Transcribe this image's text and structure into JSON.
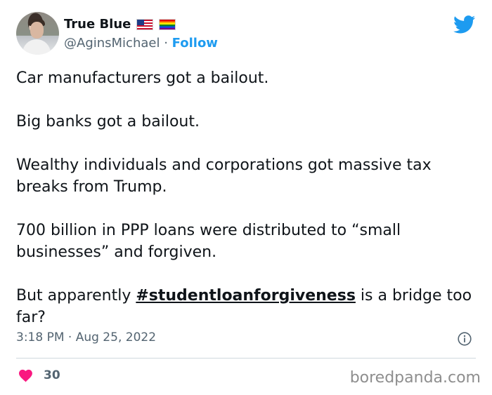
{
  "author": {
    "display_name": "True Blue",
    "handle": "@AginsMichael",
    "separator": "·",
    "follow_label": "Follow"
  },
  "tweet": {
    "paragraphs": [
      "Car manufacturers got a bailout.",
      "Big banks got a bailout.",
      "Wealthy individuals and corporations got massive tax breaks from Trump.",
      "700 billion in PPP loans were distributed to “small businesses” and forgiven."
    ],
    "last_paragraph_before": "But apparently ",
    "hashtag": "#studentloanforgiveness",
    "last_paragraph_after": " is a bridge too far?"
  },
  "timestamp": "3:18 PM · Aug 25, 2022",
  "likes": "30",
  "watermark": "boredpanda.com",
  "icons": {
    "bird": "twitter-bird-icon",
    "info": "info-icon",
    "heart": "heart-icon"
  },
  "colors": {
    "accent": "#1d9bf0",
    "heart": "#f91880",
    "muted": "#536471"
  }
}
